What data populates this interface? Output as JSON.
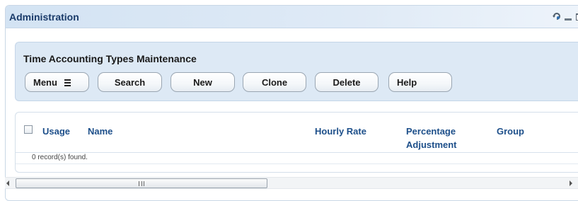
{
  "portlet": {
    "title": "Administration",
    "icons": [
      "refresh-icon",
      "minimize-icon",
      "maximize-icon"
    ]
  },
  "toolbar": {
    "title": "Time Accounting Types Maintenance",
    "buttons": {
      "menu": "Menu",
      "search": "Search",
      "new": "New",
      "clone": "Clone",
      "delete": "Delete",
      "help": "Help"
    }
  },
  "grid": {
    "columns": {
      "usage": "Usage",
      "name": "Name",
      "hourly_rate": "Hourly Rate",
      "percentage_adjustment": "Percentage Adjustment",
      "group": "Group"
    },
    "records_text": "0 record(s) found.",
    "select_all_checked": false
  },
  "colors": {
    "header_bg": "#d3e3f3",
    "toolbar_bg": "#dde9f5",
    "title_text": "#1a3b6a",
    "column_text": "#1d4f8a"
  }
}
